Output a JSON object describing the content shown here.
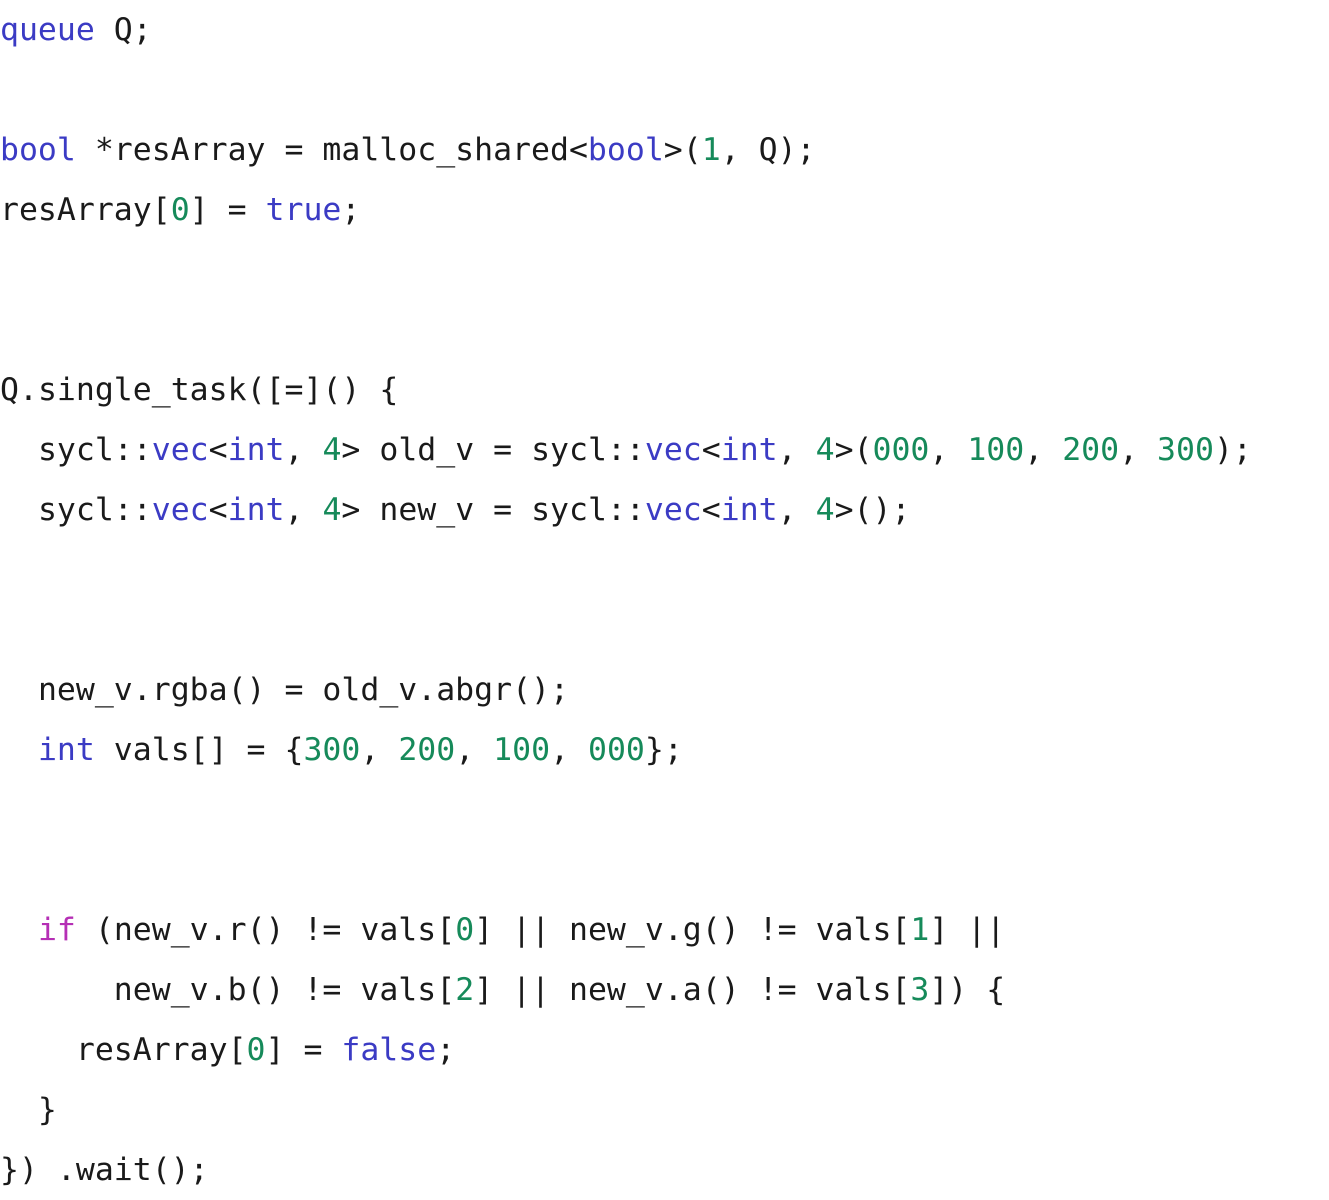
{
  "document": {
    "kind": "code-listing",
    "language": "C++ (SYCL)",
    "background_color": "#ffffff",
    "font_size_px": 31.5,
    "line_height_px": 60
  },
  "palette": {
    "plain": "#1a1a1a",
    "keyword": "#3b3bc4",
    "control": "#b52fb5",
    "function": "#8a6a12",
    "number": "#168a5a",
    "namespace": "#2f8a96",
    "variable": "#3a3ab0"
  },
  "code": {
    "lines": [
      {
        "index": 1,
        "text": "queue Q;",
        "tokens": [
          {
            "t": "queue",
            "c": "keyword"
          },
          {
            "t": " Q;",
            "c": "plain"
          }
        ]
      },
      {
        "index": 2,
        "text": "",
        "tokens": []
      },
      {
        "index": 3,
        "text": "bool *resArray = malloc_shared<bool>(1, Q);",
        "tokens": [
          {
            "t": "bool",
            "c": "keyword"
          },
          {
            "t": " *resArray = ",
            "c": "plain"
          },
          {
            "t": "malloc_shared",
            "c": "function"
          },
          {
            "t": "<",
            "c": "plain"
          },
          {
            "t": "bool",
            "c": "keyword"
          },
          {
            "t": ">(",
            "c": "plain"
          },
          {
            "t": "1",
            "c": "number"
          },
          {
            "t": ", Q);",
            "c": "plain"
          }
        ]
      },
      {
        "index": 4,
        "text": "resArray[0] = true;",
        "tokens": [
          {
            "t": "resArray",
            "c": "variable"
          },
          {
            "t": "[",
            "c": "plain"
          },
          {
            "t": "0",
            "c": "number"
          },
          {
            "t": "] = ",
            "c": "plain"
          },
          {
            "t": "true",
            "c": "keyword"
          },
          {
            "t": ";",
            "c": "plain"
          }
        ]
      },
      {
        "index": 5,
        "text": "",
        "tokens": []
      },
      {
        "index": 6,
        "text": "",
        "tokens": []
      },
      {
        "index": 7,
        "text": "Q.single_task([=]() {",
        "tokens": [
          {
            "t": "Q",
            "c": "variable"
          },
          {
            "t": ".",
            "c": "plain"
          },
          {
            "t": "single_task",
            "c": "function"
          },
          {
            "t": "([=]() {",
            "c": "plain"
          }
        ]
      },
      {
        "index": 8,
        "text": "  sycl::vec<int, 4> old_v = sycl::vec<int, 4>(000, 100, 200, 300);",
        "tokens": [
          {
            "t": "  ",
            "c": "plain"
          },
          {
            "t": "sycl",
            "c": "namespace"
          },
          {
            "t": "::",
            "c": "plain"
          },
          {
            "t": "vec",
            "c": "keyword"
          },
          {
            "t": "<",
            "c": "plain"
          },
          {
            "t": "int",
            "c": "keyword"
          },
          {
            "t": ", ",
            "c": "plain"
          },
          {
            "t": "4",
            "c": "number"
          },
          {
            "t": "> old_v = ",
            "c": "plain"
          },
          {
            "t": "sycl",
            "c": "namespace"
          },
          {
            "t": "::",
            "c": "plain"
          },
          {
            "t": "vec",
            "c": "keyword"
          },
          {
            "t": "<",
            "c": "plain"
          },
          {
            "t": "int",
            "c": "keyword"
          },
          {
            "t": ", ",
            "c": "plain"
          },
          {
            "t": "4",
            "c": "number"
          },
          {
            "t": ">(",
            "c": "plain"
          },
          {
            "t": "000",
            "c": "number"
          },
          {
            "t": ", ",
            "c": "plain"
          },
          {
            "t": "100",
            "c": "number"
          },
          {
            "t": ", ",
            "c": "plain"
          },
          {
            "t": "200",
            "c": "number"
          },
          {
            "t": ", ",
            "c": "plain"
          },
          {
            "t": "300",
            "c": "number"
          },
          {
            "t": ");",
            "c": "plain"
          }
        ]
      },
      {
        "index": 9,
        "text": "  sycl::vec<int, 4> new_v = sycl::vec<int, 4>();",
        "tokens": [
          {
            "t": "  ",
            "c": "plain"
          },
          {
            "t": "sycl",
            "c": "namespace"
          },
          {
            "t": "::",
            "c": "plain"
          },
          {
            "t": "vec",
            "c": "keyword"
          },
          {
            "t": "<",
            "c": "plain"
          },
          {
            "t": "int",
            "c": "keyword"
          },
          {
            "t": ", ",
            "c": "plain"
          },
          {
            "t": "4",
            "c": "number"
          },
          {
            "t": "> new_v = ",
            "c": "plain"
          },
          {
            "t": "sycl",
            "c": "namespace"
          },
          {
            "t": "::",
            "c": "plain"
          },
          {
            "t": "vec",
            "c": "keyword"
          },
          {
            "t": "<",
            "c": "plain"
          },
          {
            "t": "int",
            "c": "keyword"
          },
          {
            "t": ", ",
            "c": "plain"
          },
          {
            "t": "4",
            "c": "number"
          },
          {
            "t": ">();",
            "c": "plain"
          }
        ]
      },
      {
        "index": 10,
        "text": "",
        "tokens": []
      },
      {
        "index": 11,
        "text": "",
        "tokens": []
      },
      {
        "index": 12,
        "text": "  new_v.rgba() = old_v.abgr();",
        "tokens": [
          {
            "t": "  ",
            "c": "plain"
          },
          {
            "t": "new_v",
            "c": "variable"
          },
          {
            "t": ".",
            "c": "plain"
          },
          {
            "t": "rgba",
            "c": "function"
          },
          {
            "t": "() = ",
            "c": "plain"
          },
          {
            "t": "old_v",
            "c": "variable"
          },
          {
            "t": ".",
            "c": "plain"
          },
          {
            "t": "abgr",
            "c": "function"
          },
          {
            "t": "();",
            "c": "plain"
          }
        ]
      },
      {
        "index": 13,
        "text": "  int vals[] = {300, 200, 100, 000};",
        "tokens": [
          {
            "t": "  ",
            "c": "plain"
          },
          {
            "t": "int",
            "c": "keyword"
          },
          {
            "t": " vals[] = {",
            "c": "plain"
          },
          {
            "t": "300",
            "c": "number"
          },
          {
            "t": ", ",
            "c": "plain"
          },
          {
            "t": "200",
            "c": "number"
          },
          {
            "t": ", ",
            "c": "plain"
          },
          {
            "t": "100",
            "c": "number"
          },
          {
            "t": ", ",
            "c": "plain"
          },
          {
            "t": "000",
            "c": "number"
          },
          {
            "t": "};",
            "c": "plain"
          }
        ]
      },
      {
        "index": 14,
        "text": "",
        "tokens": []
      },
      {
        "index": 15,
        "text": "",
        "tokens": []
      },
      {
        "index": 16,
        "text": "  if (new_v.r() != vals[0] || new_v.g() != vals[1] ||",
        "tokens": [
          {
            "t": "  ",
            "c": "plain"
          },
          {
            "t": "if",
            "c": "control"
          },
          {
            "t": " (",
            "c": "plain"
          },
          {
            "t": "new_v",
            "c": "variable"
          },
          {
            "t": ".",
            "c": "plain"
          },
          {
            "t": "r",
            "c": "function"
          },
          {
            "t": "() != ",
            "c": "plain"
          },
          {
            "t": "vals",
            "c": "variable"
          },
          {
            "t": "[",
            "c": "plain"
          },
          {
            "t": "0",
            "c": "number"
          },
          {
            "t": "] || ",
            "c": "plain"
          },
          {
            "t": "new_v",
            "c": "variable"
          },
          {
            "t": ".",
            "c": "plain"
          },
          {
            "t": "g",
            "c": "function"
          },
          {
            "t": "() != ",
            "c": "plain"
          },
          {
            "t": "vals",
            "c": "variable"
          },
          {
            "t": "[",
            "c": "plain"
          },
          {
            "t": "1",
            "c": "number"
          },
          {
            "t": "] ||",
            "c": "plain"
          }
        ]
      },
      {
        "index": 17,
        "text": "      new_v.b() != vals[2] || new_v.a() != vals[3]) {",
        "tokens": [
          {
            "t": "      ",
            "c": "plain"
          },
          {
            "t": "new_v",
            "c": "variable"
          },
          {
            "t": ".",
            "c": "plain"
          },
          {
            "t": "b",
            "c": "function"
          },
          {
            "t": "() != ",
            "c": "plain"
          },
          {
            "t": "vals",
            "c": "variable"
          },
          {
            "t": "[",
            "c": "plain"
          },
          {
            "t": "2",
            "c": "number"
          },
          {
            "t": "] || ",
            "c": "plain"
          },
          {
            "t": "new_v",
            "c": "variable"
          },
          {
            "t": ".",
            "c": "plain"
          },
          {
            "t": "a",
            "c": "function"
          },
          {
            "t": "() != ",
            "c": "plain"
          },
          {
            "t": "vals",
            "c": "variable"
          },
          {
            "t": "[",
            "c": "plain"
          },
          {
            "t": "3",
            "c": "number"
          },
          {
            "t": "]) {",
            "c": "plain"
          }
        ]
      },
      {
        "index": 18,
        "text": "    resArray[0] = false;",
        "tokens": [
          {
            "t": "    ",
            "c": "plain"
          },
          {
            "t": "resArray",
            "c": "variable"
          },
          {
            "t": "[",
            "c": "plain"
          },
          {
            "t": "0",
            "c": "number"
          },
          {
            "t": "] = ",
            "c": "plain"
          },
          {
            "t": "false",
            "c": "keyword"
          },
          {
            "t": ";",
            "c": "plain"
          }
        ]
      },
      {
        "index": 19,
        "text": "  }",
        "tokens": [
          {
            "t": "  }",
            "c": "plain"
          }
        ]
      },
      {
        "index": 20,
        "text": "}) .wait();",
        "tokens": [
          {
            "t": "}) .",
            "c": "plain"
          },
          {
            "t": "wait",
            "c": "function"
          },
          {
            "t": "();",
            "c": "plain"
          }
        ]
      }
    ]
  }
}
